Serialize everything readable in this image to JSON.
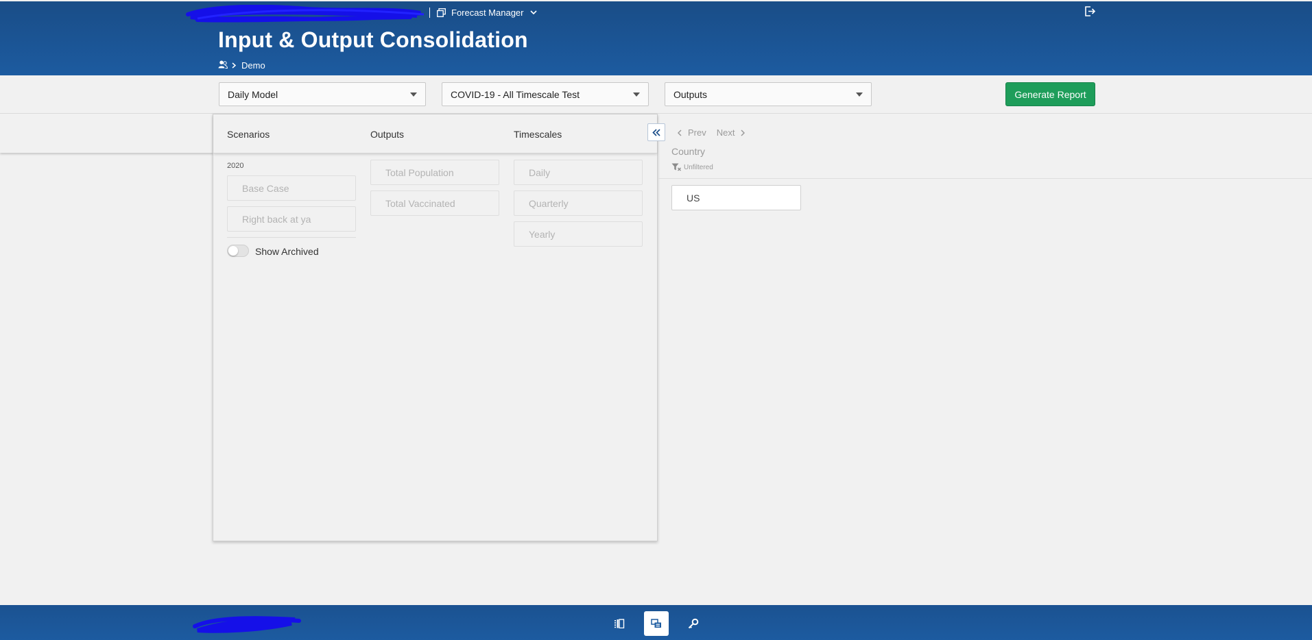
{
  "header": {
    "app_switch_label": "Forecast Manager",
    "page_title": "Input & Output Consolidation",
    "breadcrumb_current": "Demo"
  },
  "toolbar": {
    "model_select": "Daily Model",
    "scenario_select": "COVID-19 - All Timescale Test",
    "view_select": "Outputs",
    "generate_label": "Generate Report"
  },
  "panel": {
    "scenarios_title": "Scenarios",
    "outputs_title": "Outputs",
    "timescales_title": "Timescales",
    "year_group": "2020",
    "scenarios": [
      "Base Case",
      "Right back at ya"
    ],
    "outputs": [
      "Total Population",
      "Total Vaccinated"
    ],
    "timescales": [
      "Daily",
      "Quarterly",
      "Yearly"
    ],
    "show_archived_label": "Show Archived",
    "show_archived": false
  },
  "filter": {
    "prev_label": "Prev",
    "next_label": "Next",
    "dimension_title": "Country",
    "status": "Unfiltered",
    "members": [
      "US"
    ]
  },
  "colors": {
    "header_blue": "#1c5ba0",
    "generate_green": "#1e9d5a",
    "background": "#f1f1f1"
  },
  "icons": [
    "window-icon",
    "chevron-down-icon",
    "logout-icon",
    "users-icon",
    "chevron-right-icon",
    "double-chevron-left-icon",
    "chevron-left-icon",
    "filter-clear-icon",
    "book-icon",
    "consolidation-icon",
    "key-icon"
  ]
}
